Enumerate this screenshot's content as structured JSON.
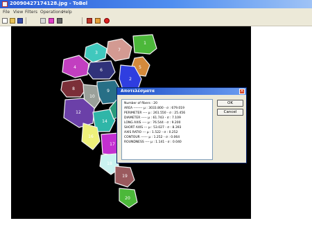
{
  "window": {
    "title": "20090427174128.jpg - ToBel"
  },
  "menu": [
    "File",
    "View",
    "Filters",
    "Operations",
    "Help"
  ],
  "toolbar": [
    "new-icon",
    "open-icon",
    "save-icon",
    "sep",
    "copy-icon",
    "paint-icon",
    "layer-icon",
    "sep",
    "pen-icon",
    "draw-icon",
    "help-icon"
  ],
  "regions": [
    {
      "label": "1",
      "color": "#4cb83a"
    },
    {
      "label": "2",
      "color": "#2f3ee0"
    },
    {
      "label": "3",
      "color": "#40c8bd"
    },
    {
      "label": "4",
      "color": "#c23fc0"
    },
    {
      "label": "5",
      "color": "#d48a3c"
    },
    {
      "label": "6",
      "color": "#30327a"
    },
    {
      "label": "7",
      "color": "#d39a92"
    },
    {
      "label": "8",
      "color": "#7b2f38"
    },
    {
      "label": "9",
      "color": "#276f86"
    },
    {
      "label": "10",
      "color": "#9aa09a"
    },
    {
      "label": "11",
      "color": "#6f61d9"
    },
    {
      "label": "12",
      "color": "#6b40a8"
    },
    {
      "label": "14",
      "color": "#2fb6a8"
    },
    {
      "label": "16",
      "color": "#eef07a"
    },
    {
      "label": "17",
      "color": "#c32fd0"
    },
    {
      "label": "18",
      "color": "#c9f2f0"
    },
    {
      "label": "19",
      "color": "#9a5a5e"
    },
    {
      "label": "20",
      "color": "#4cb83a"
    },
    {
      "label": "",
      "color": "#2a9a7a"
    }
  ],
  "dialog": {
    "title": "Αποτελέσματα",
    "lines": [
      "Number of fibers : 20",
      "AREA -------- μ : 3033.800 - σ : 679.019",
      "PERIMETER ---- μ : 261.550 - σ : 25.456",
      "DIAMETER ----- μ : 61.743 - σ : 7.109",
      "LONG AXIS ---- μ : 76.544 - σ : 9.200",
      "SHORT AXIS --- μ : 53.027 - σ : 8.393",
      "AXIS RATIO --- μ : 1.522 - σ : 0.252",
      "CONTOUR ------ μ : 1.252 - σ : 0.064",
      "ROUNDNESS ---- μ : 1.141 - σ : 0.040"
    ],
    "ok_label": "OK",
    "cancel_label": "Cancel"
  }
}
